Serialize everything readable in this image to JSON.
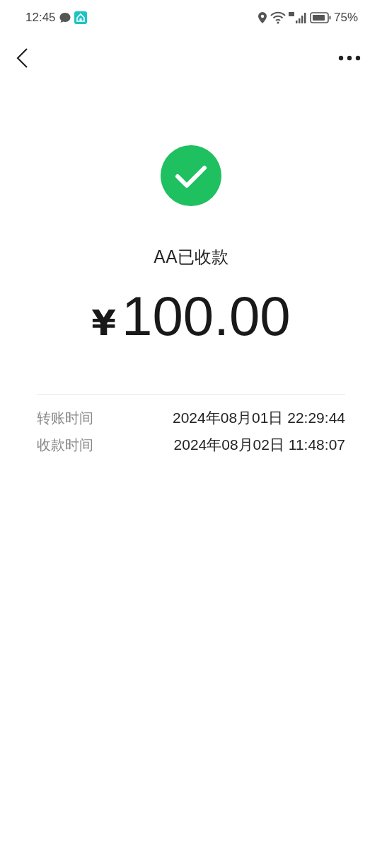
{
  "status_bar": {
    "time": "12:45",
    "battery": "75%"
  },
  "status": {
    "title": "AA已收款",
    "currency": "¥",
    "amount": "100.00"
  },
  "details": [
    {
      "label": "转账时间",
      "value": "2024年08月01日 22:29:44"
    },
    {
      "label": "收款时间",
      "value": "2024年08月02日 11:48:07"
    }
  ]
}
